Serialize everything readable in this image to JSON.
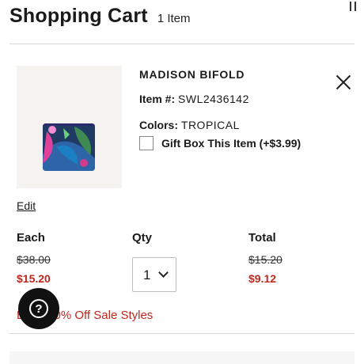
{
  "header": {
    "title": "Shopping Cart",
    "item_count": "1 Item"
  },
  "product": {
    "name": "MADISON BIFOLD",
    "item_label": "Item #:",
    "item_number": "SWL2436142",
    "colors_label": "Colors:",
    "color": "TROPICAL",
    "gift_label": "Gift Box This Item (+$3.99)",
    "gift_checked": false,
    "edit_label": "Edit"
  },
  "pricing": {
    "each_label": "Each",
    "qty_label": "Qty",
    "total_label": "Total",
    "each_original": "$38.00",
    "each_sale": "$15.20",
    "qty_value": "1",
    "total_original": "$15.20",
    "total_sale": "$9.12",
    "promo_text": "Extra 40% Off Sale Styles"
  },
  "help": {
    "icon": "?"
  },
  "colors": {
    "sale_red": "#c0271d",
    "help_bg": "#111111"
  }
}
